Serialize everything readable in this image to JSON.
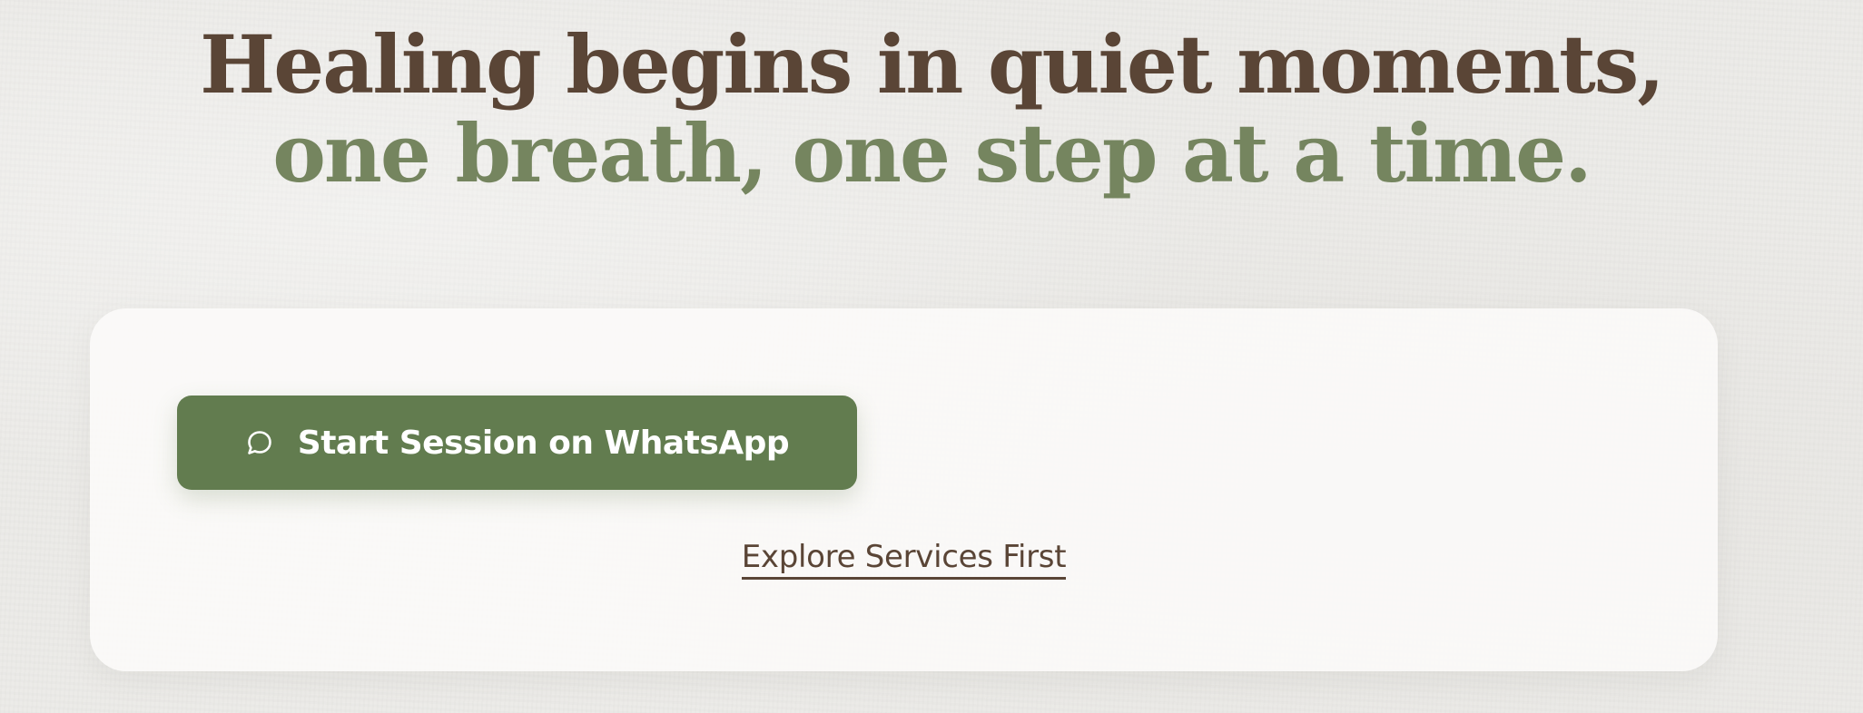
{
  "hero": {
    "line1": "Healing begins in quiet moments,",
    "line2": "one breath, one step at a time."
  },
  "cta": {
    "primary_label": "Start Session on WhatsApp",
    "primary_icon": "chat-bubble-icon",
    "secondary_label": "Explore Services First"
  },
  "colors": {
    "heading_brown": "#5a4536",
    "heading_green": "#75855f",
    "button_green": "#627c4f",
    "card_bg": "#fbfaf9",
    "page_bg": "#ecebe8"
  }
}
